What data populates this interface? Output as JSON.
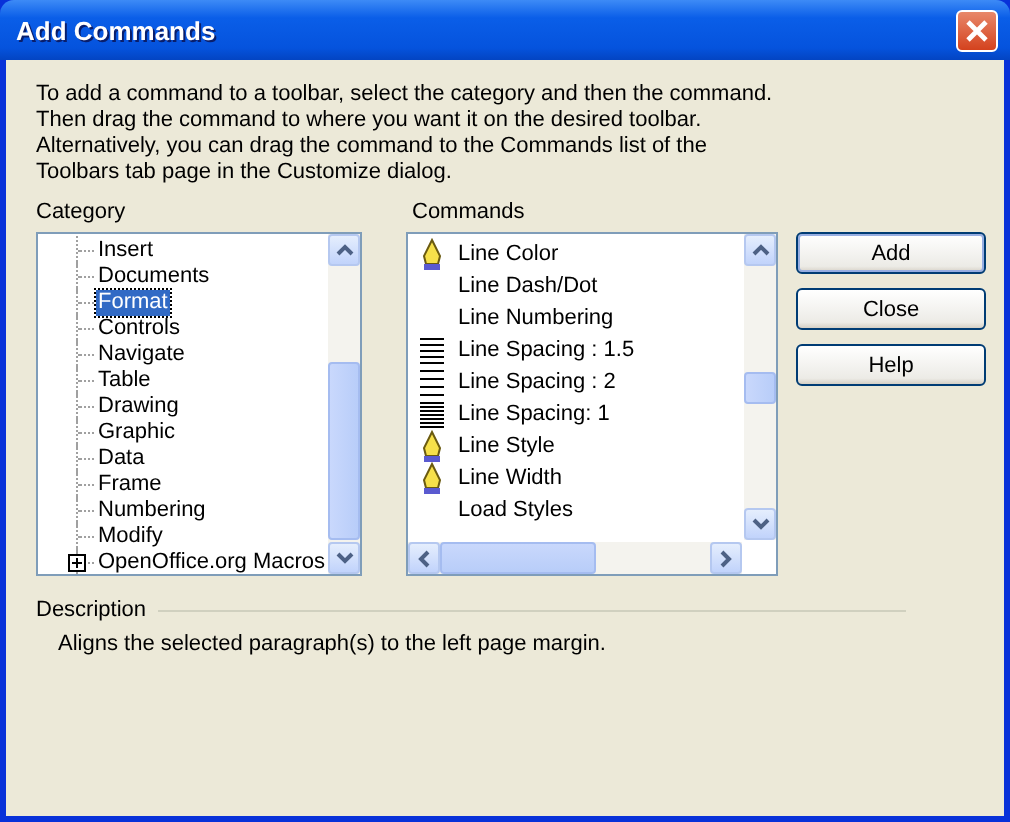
{
  "window": {
    "title": "Add Commands"
  },
  "intro": "To add a command to a toolbar, select the category and then the command.\nThen drag the command to where you want it on the desired toolbar.\nAlternatively, you can drag the command to the Commands list of the\nToolbars tab page in the Customize dialog.",
  "category": {
    "label": "Category",
    "items": [
      {
        "label": "Insert",
        "kind": "leaf",
        "selected": false
      },
      {
        "label": "Documents",
        "kind": "leaf",
        "selected": false
      },
      {
        "label": "Format",
        "kind": "leaf",
        "selected": true
      },
      {
        "label": "Controls",
        "kind": "leaf",
        "selected": false
      },
      {
        "label": "Navigate",
        "kind": "leaf",
        "selected": false
      },
      {
        "label": "Table",
        "kind": "leaf",
        "selected": false
      },
      {
        "label": "Drawing",
        "kind": "leaf",
        "selected": false
      },
      {
        "label": "Graphic",
        "kind": "leaf",
        "selected": false
      },
      {
        "label": "Data",
        "kind": "leaf",
        "selected": false
      },
      {
        "label": "Frame",
        "kind": "leaf",
        "selected": false
      },
      {
        "label": "Numbering",
        "kind": "leaf",
        "selected": false
      },
      {
        "label": "Modify",
        "kind": "leaf",
        "selected": false
      },
      {
        "label": "OpenOffice.org Macros",
        "kind": "folder",
        "expanded": false,
        "selected": false
      }
    ]
  },
  "commands": {
    "label": "Commands",
    "items": [
      {
        "label": "Line Color",
        "kind": "pen",
        "selected": false
      },
      {
        "label": "Line Dash/Dot",
        "kind": "plain",
        "selected": false
      },
      {
        "label": "Line Numbering",
        "kind": "plain",
        "selected": false
      },
      {
        "label": "Line Spacing : 1.5",
        "kind": "wide",
        "selected": false
      },
      {
        "label": "Line Spacing : 2",
        "kind": "double",
        "selected": false
      },
      {
        "label": "Line Spacing: 1",
        "kind": "single",
        "selected": false
      },
      {
        "label": "Line Style",
        "kind": "pen",
        "selected": false
      },
      {
        "label": "Line Width",
        "kind": "pen",
        "selected": false
      },
      {
        "label": "Load Styles",
        "kind": "plain",
        "selected": false
      }
    ]
  },
  "buttons": [
    {
      "label": "Add",
      "default": true
    },
    {
      "label": "Close",
      "default": false
    },
    {
      "label": "Help",
      "default": false
    }
  ],
  "description": {
    "label": "Description",
    "text": "Aligns the selected paragraph(s) to the left page margin."
  }
}
